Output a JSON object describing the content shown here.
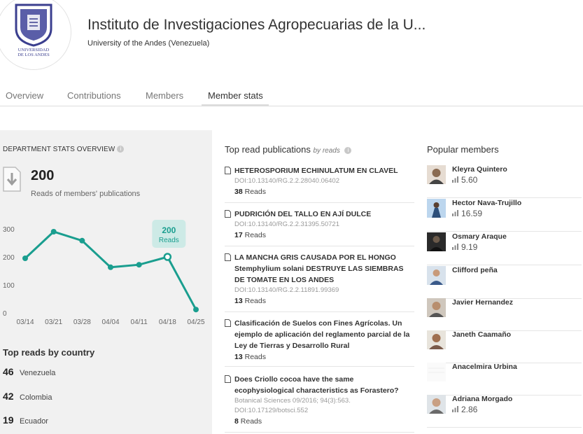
{
  "header": {
    "title": "Instituto de Investigaciones Agropecuarias de la U...",
    "subtitle": "University of the Andes (Venezuela)",
    "logo_text": "UNIVERSIDAD DE LOS ANDES"
  },
  "tabs": [
    {
      "label": "Overview"
    },
    {
      "label": "Contributions"
    },
    {
      "label": "Members"
    },
    {
      "label": "Member stats",
      "active": true
    }
  ],
  "stats": {
    "heading": "DEPARTMENT STATS OVERVIEW",
    "reads_value": "200",
    "reads_caption": "Reads of members' publications",
    "tooltip_value": "200",
    "tooltip_label": "Reads"
  },
  "chart_data": {
    "type": "line",
    "x": [
      "03/14",
      "03/21",
      "03/28",
      "04/04",
      "04/11",
      "04/18",
      "04/25"
    ],
    "values": [
      195,
      290,
      258,
      163,
      172,
      200,
      12
    ],
    "ylim": [
      0,
      300
    ],
    "yticks": [
      "300",
      "200",
      "100",
      "0"
    ],
    "highlight_index": 5,
    "color": "#1a9e8f"
  },
  "countries": {
    "heading": "Top reads by country",
    "items": [
      {
        "count": "46",
        "name": "Venezuela"
      },
      {
        "count": "42",
        "name": "Colombia"
      },
      {
        "count": "19",
        "name": "Ecuador"
      }
    ]
  },
  "publications": {
    "heading": "Top read publications",
    "heading_sub": "by reads",
    "items": [
      {
        "title": "HETEROSPORIUM ECHINULATUM EN CLAVEL",
        "meta": "DOI:10.13140/RG.2.2.28040.06402",
        "reads": "38",
        "reads_label": "Reads"
      },
      {
        "title": "PUDRICIÓN DEL TALLO EN AJÍ DULCE",
        "meta": "DOI:10.13140/RG.2.2.31395.50721",
        "reads": "17",
        "reads_label": "Reads"
      },
      {
        "title": "LA MANCHA GRIS CAUSADA POR EL HONGO Stemphylium solani DESTRUYE LAS SIEMBRAS DE TOMATE EN LOS ANDES",
        "meta": "DOI:10.13140/RG.2.2.11891.99369",
        "reads": "13",
        "reads_label": "Reads"
      },
      {
        "title": "Clasificación de Suelos con Fines Agrícolas. Un ejemplo de aplicación del reglamento parcial de la Ley de Tierras y Desarrollo Rural",
        "meta": "",
        "reads": "13",
        "reads_label": "Reads"
      },
      {
        "title": "Does Criollo cocoa have the same ecophysiological characteristics as Forastero?",
        "meta": "Botanical Sciences 09/2016; 94(3):563. DOI:10.17129/botsci.552",
        "reads": "8",
        "reads_label": "Reads"
      }
    ]
  },
  "members": {
    "heading": "Popular members",
    "items": [
      {
        "name": "Kleyra Quintero",
        "score": "5.60"
      },
      {
        "name": "Hector Nava-Trujillo",
        "score": "16.59"
      },
      {
        "name": "Osmary Araque",
        "score": "9.19"
      },
      {
        "name": "Clifford peña",
        "score": ""
      },
      {
        "name": "Javier Hernandez",
        "score": ""
      },
      {
        "name": "Janeth Caamaño",
        "score": ""
      },
      {
        "name": "Anacelmira Urbina",
        "score": ""
      },
      {
        "name": "Adriana Morgado",
        "score": "2.86"
      }
    ]
  }
}
